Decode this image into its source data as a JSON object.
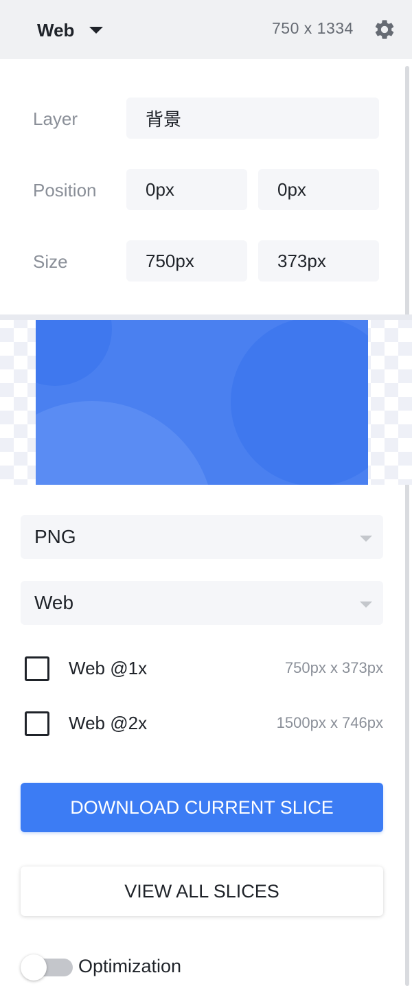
{
  "header": {
    "platform_label": "Web",
    "canvas_size": "750 x 1334",
    "settings_icon": "gear-icon"
  },
  "properties": {
    "layer_label": "Layer",
    "layer_value": "背景",
    "position_label": "Position",
    "position_x": "0px",
    "position_y": "0px",
    "size_label": "Size",
    "size_width": "750px",
    "size_height": "373px"
  },
  "preview": {
    "background_color": "#4a80f0",
    "circle_color": "#5a8cf3",
    "checker_color": "#eef0f7"
  },
  "export": {
    "format_selected": "PNG",
    "platform_selected": "Web",
    "scales": [
      {
        "label": "Web @1x",
        "dimensions": "750px x 373px",
        "checked": false
      },
      {
        "label": "Web @2x",
        "dimensions": "1500px x 746px",
        "checked": false
      }
    ]
  },
  "actions": {
    "download_label": "DOWNLOAD CURRENT SLICE",
    "view_all_label": "VIEW ALL SLICES"
  },
  "optimization": {
    "label": "Optimization",
    "enabled": false
  },
  "colors": {
    "accent": "#3c7cf4",
    "header_bg": "#f0f1f3",
    "field_bg": "#f5f6f9"
  }
}
